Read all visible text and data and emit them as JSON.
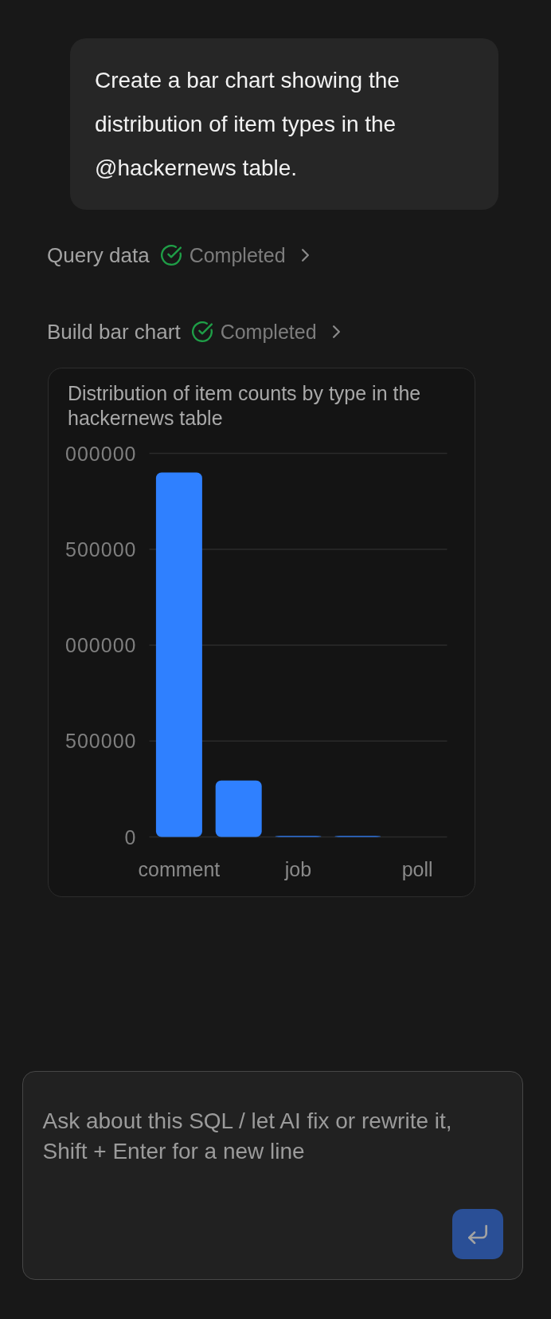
{
  "message": {
    "text": "Create a bar chart showing the distribution of item types in the @hackernews table."
  },
  "steps": [
    {
      "title": "Query data",
      "completed": true,
      "status": "Completed",
      "expanded": false
    },
    {
      "title": "Build bar chart",
      "completed": true,
      "status": "Completed",
      "expanded": false
    }
  ],
  "chart_card": {
    "title": "Distribution of item counts by type in the hackernews table",
    "y_axis_labels": [
      "000000",
      "500000",
      "000000",
      "500000",
      "0"
    ],
    "x_axis_labels": [
      "comment",
      "job",
      "poll"
    ]
  },
  "composer": {
    "placeholder": "Ask about this SQL / let AI fix or rewrite it, Shift + Enter for a new line",
    "send_button": {
      "disabled": true
    }
  }
}
